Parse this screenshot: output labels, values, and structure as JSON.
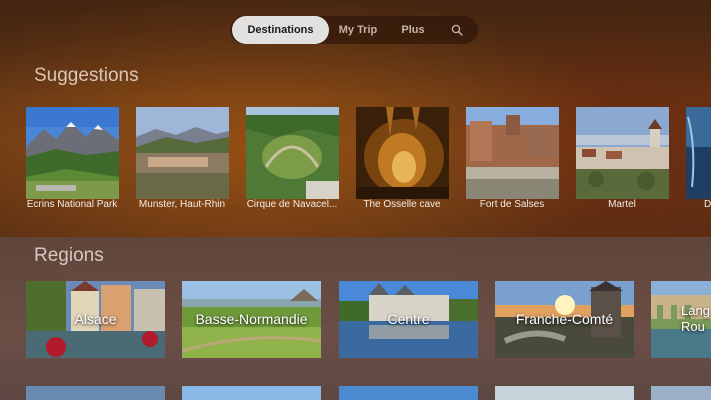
{
  "tabs": [
    {
      "label": "Destinations",
      "active": true
    },
    {
      "label": "My Trip",
      "active": false
    },
    {
      "label": "Plus",
      "active": false
    }
  ],
  "search_icon": "search-icon",
  "sections": {
    "suggestions": "Suggestions",
    "regions": "Regions"
  },
  "suggestions": [
    {
      "label": "Écrins National Park"
    },
    {
      "label": "Munster, Haut-Rhin"
    },
    {
      "label": "Cirque de Navacel..."
    },
    {
      "label": "The Osselle cave"
    },
    {
      "label": "Fort de Salses"
    },
    {
      "label": "Martel"
    },
    {
      "label": "D"
    }
  ],
  "regions": [
    {
      "label": "Alsace"
    },
    {
      "label": "Basse-Normandie"
    },
    {
      "label": "Centre"
    },
    {
      "label": "Franche-Comté"
    },
    {
      "label": "Lang Rou"
    }
  ],
  "colors": {
    "active_tab_bg": "#e3e1df",
    "background": "#5a2f14"
  }
}
